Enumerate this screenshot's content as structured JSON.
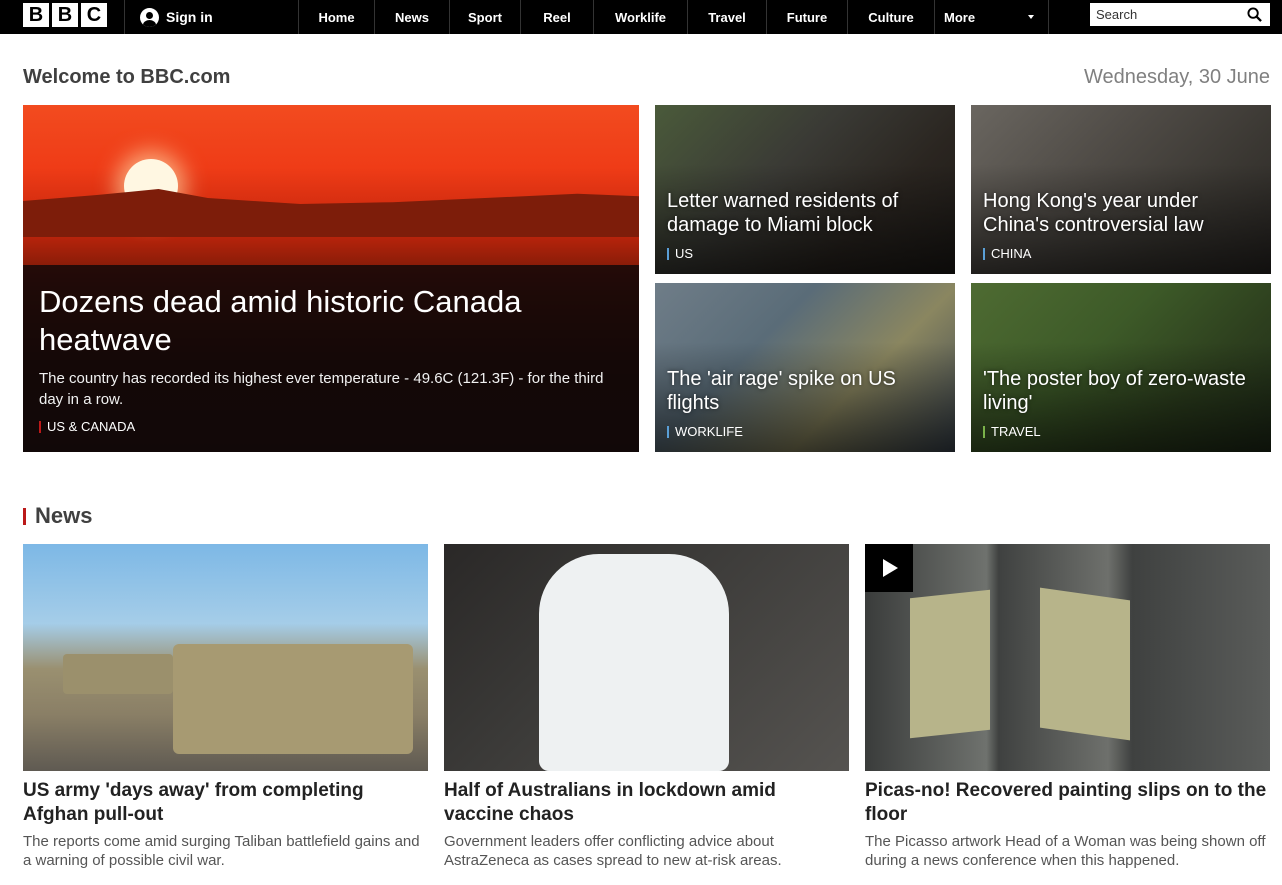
{
  "header": {
    "logo_letters": [
      "B",
      "B",
      "C"
    ],
    "signin_label": "Sign in",
    "nav": [
      {
        "label": "Home"
      },
      {
        "label": "News"
      },
      {
        "label": "Sport"
      },
      {
        "label": "Reel"
      },
      {
        "label": "Worklife"
      },
      {
        "label": "Travel"
      },
      {
        "label": "Future"
      },
      {
        "label": "Culture"
      },
      {
        "label": "More"
      }
    ],
    "search_placeholder": "Search"
  },
  "welcome": {
    "title": "Welcome to BBC.com",
    "date": "Wednesday, 30 June"
  },
  "hero": {
    "title": "Dozens dead amid historic Canada heatwave",
    "summary": "The country has recorded its highest ever temperature - 49.6C (121.3F) - for the third day in a row.",
    "tag": "US & CANADA",
    "tag_color": "#bb1919"
  },
  "top_stories": [
    {
      "title": "Letter warned residents of damage to Miami block",
      "tag": "US",
      "tag_color": "#5a9fd6"
    },
    {
      "title": "Hong Kong's year under China's controversial law",
      "tag": "CHINA",
      "tag_color": "#5a9fd6"
    },
    {
      "title": "The 'air rage' spike on US flights",
      "tag": "WORKLIFE",
      "tag_color": "#5a9fd6"
    },
    {
      "title": "'The poster boy of zero-waste living'",
      "tag": "TRAVEL",
      "tag_color": "#7bb24a"
    }
  ],
  "news": {
    "section_title": "News",
    "items": [
      {
        "title": "US army 'days away' from completing Afghan pull-out",
        "summary": "The reports come amid surging Taliban battlefield gains and a warning of possible civil war."
      },
      {
        "title": "Half of Australians in lockdown amid vaccine chaos",
        "summary": "Government leaders offer conflicting advice about AstraZeneca as cases spread to new at-risk areas."
      },
      {
        "title": "Picas-no! Recovered painting slips on to the floor",
        "summary": "The Picasso artwork Head of a Woman was being shown off during a news conference when this happened."
      }
    ]
  }
}
